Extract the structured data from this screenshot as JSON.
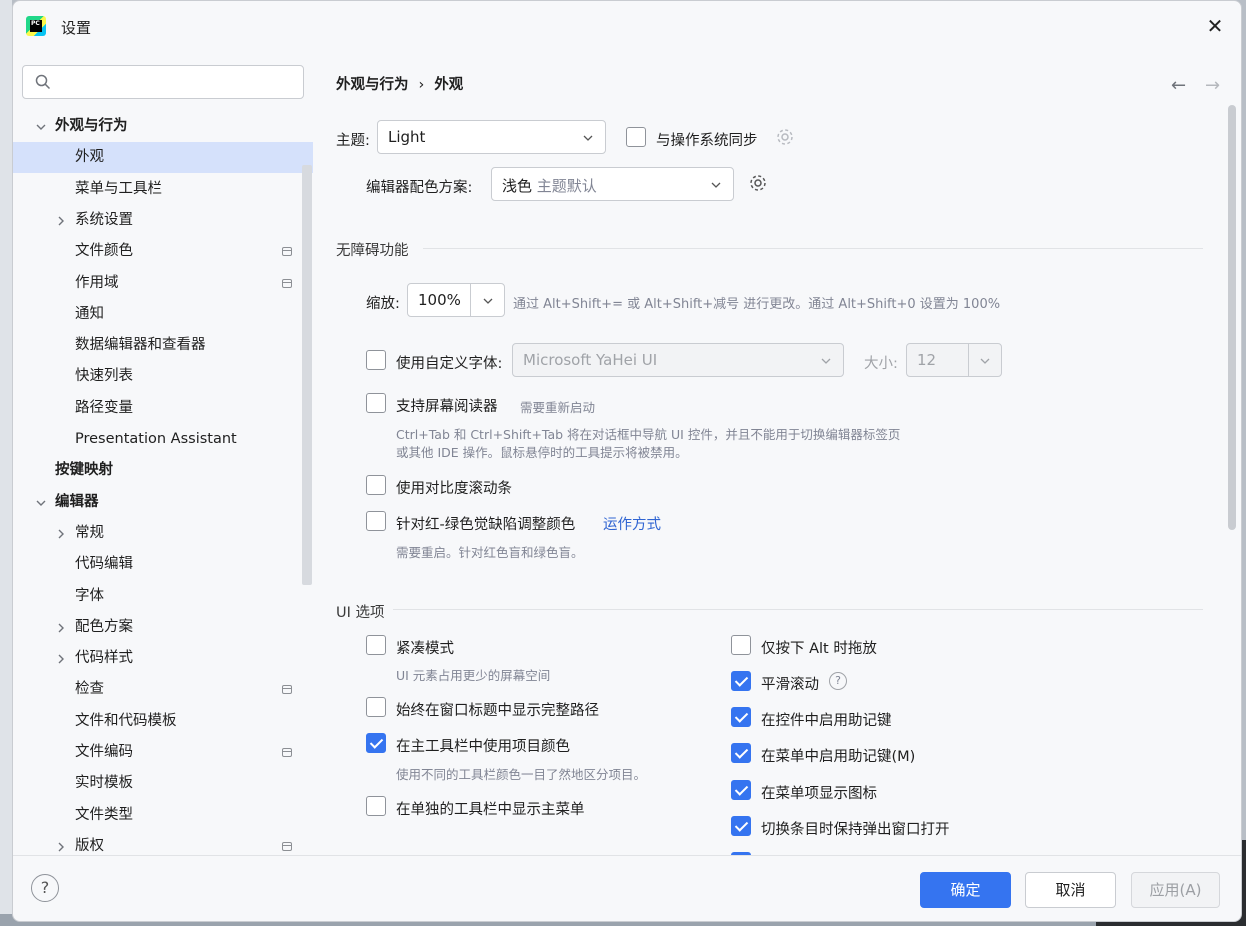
{
  "window": {
    "title": "设置",
    "close_label": "✕"
  },
  "search": {
    "placeholder": ""
  },
  "tree": [
    {
      "label": "外观与行为",
      "bold": true,
      "level": 0,
      "expanded": true
    },
    {
      "label": "外观",
      "level": 1,
      "selected": true
    },
    {
      "label": "菜单与工具栏",
      "level": 1
    },
    {
      "label": "系统设置",
      "level": 1,
      "collapsed": true
    },
    {
      "label": "文件颜色",
      "level": 1,
      "pin": true
    },
    {
      "label": "作用域",
      "level": 1,
      "pin": true
    },
    {
      "label": "通知",
      "level": 1
    },
    {
      "label": "数据编辑器和查看器",
      "level": 1
    },
    {
      "label": "快速列表",
      "level": 1
    },
    {
      "label": "路径变量",
      "level": 1
    },
    {
      "label": "Presentation Assistant",
      "level": 1
    },
    {
      "label": "按键映射",
      "bold": true,
      "level": 0
    },
    {
      "label": "编辑器",
      "bold": true,
      "level": 0,
      "expanded": true
    },
    {
      "label": "常规",
      "level": 1,
      "collapsed": true
    },
    {
      "label": "代码编辑",
      "level": 1
    },
    {
      "label": "字体",
      "level": 1
    },
    {
      "label": "配色方案",
      "level": 1,
      "collapsed": true
    },
    {
      "label": "代码样式",
      "level": 1,
      "collapsed": true
    },
    {
      "label": "检查",
      "level": 1,
      "pin": true
    },
    {
      "label": "文件和代码模板",
      "level": 1
    },
    {
      "label": "文件编码",
      "level": 1,
      "pin": true
    },
    {
      "label": "实时模板",
      "level": 1
    },
    {
      "label": "文件类型",
      "level": 1
    },
    {
      "label": "版权",
      "level": 1,
      "collapsed": true,
      "pin": true
    }
  ],
  "breadcrumb": {
    "parent": "外观与行为",
    "sep": "›",
    "current": "外观"
  },
  "nav": {
    "back": "←",
    "forward": "→"
  },
  "theme": {
    "label": "主题:",
    "value": "Light",
    "sync_label": "与操作系统同步",
    "sync_checked": false
  },
  "editor_scheme": {
    "label": "编辑器配色方案:",
    "value": "浅色",
    "value_hint": "主题默认"
  },
  "accessibility": {
    "title": "无障碍功能",
    "zoom_label": "缩放:",
    "zoom_value": "100%",
    "zoom_hint": "通过 Alt+Shift+= 或 Alt+Shift+减号 进行更改。通过 Alt+Shift+0 设置为 100%",
    "custom_font_label": "使用自定义字体:",
    "custom_font_checked": false,
    "custom_font_value": "Microsoft YaHei UI",
    "size_label": "大小:",
    "size_value": "12",
    "screen_reader_label": "支持屏幕阅读器",
    "screen_reader_checked": false,
    "screen_reader_hint": "需要重新启动",
    "screen_reader_desc1": "Ctrl+Tab 和 Ctrl+Shift+Tab 将在对话框中导航 UI 控件，并且不能用于切换编辑器标签页",
    "screen_reader_desc2": "或其他 IDE 操作。鼠标悬停时的工具提示将被禁用。",
    "contrast_scroll_label": "使用对比度滚动条",
    "contrast_scroll_checked": false,
    "color_deficiency_label": "针对红-绿色觉缺陷调整颜色",
    "color_deficiency_checked": false,
    "color_deficiency_link": "运作方式",
    "color_deficiency_hint": "需要重启。针对红色盲和绿色盲。"
  },
  "ui_options": {
    "title": "UI 选项",
    "compact_label": "紧凑模式",
    "compact_checked": false,
    "compact_hint": "UI 元素占用更少的屏幕空间",
    "full_path_label": "始终在窗口标题中显示完整路径",
    "full_path_checked": false,
    "project_color_label": "在主工具栏中使用项目颜色",
    "project_color_checked": true,
    "project_color_hint": "使用不同的工具栏颜色一目了然地区分项目。",
    "main_menu_label": "在单独的工具栏中显示主菜单",
    "main_menu_checked": false,
    "alt_drag_label": "仅按下 Alt 时拖放",
    "alt_drag_checked": false,
    "smooth_scroll_label": "平滑滚动",
    "smooth_scroll_checked": true,
    "smooth_scroll_help": "?",
    "mnemonic_controls_label": "在控件中启用助记键",
    "mnemonic_controls_checked": true,
    "mnemonic_menu_label": "在菜单中启用助记键(M)",
    "mnemonic_menu_checked": true,
    "menu_icons_label": "在菜单项显示图标",
    "menu_icons_checked": true,
    "keep_popup_label": "切换条目时保持弹出窗口打开",
    "keep_popup_checked": true
  },
  "footer": {
    "help": "?",
    "ok": "确定",
    "cancel": "取消",
    "apply": "应用(A)"
  },
  "colors": {
    "accent": "#3574f0",
    "selection": "#d5e1fb",
    "link": "#2f64d2"
  }
}
